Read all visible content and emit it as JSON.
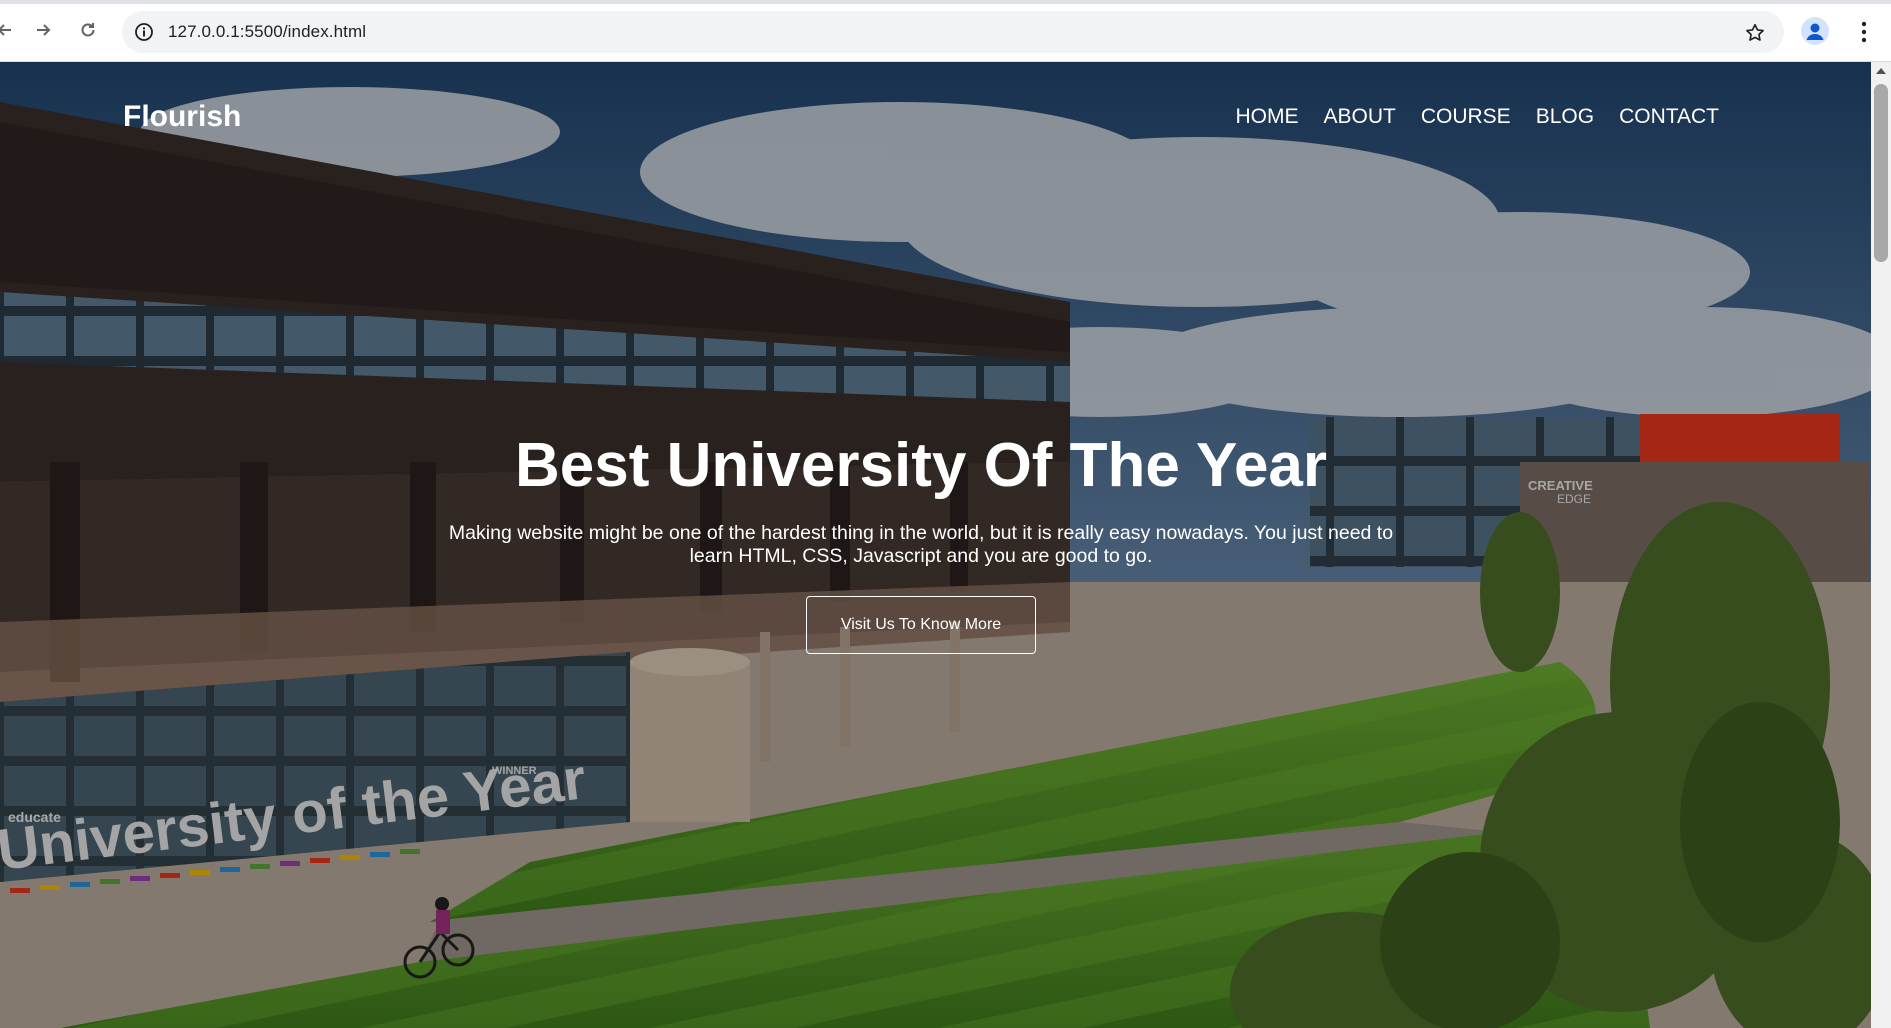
{
  "browser": {
    "url": "127.0.0.1:5500/index.html",
    "icons": [
      "back-icon",
      "forward-icon",
      "reload-icon",
      "info-icon",
      "star-icon",
      "profile-icon",
      "menu-kebab-icon"
    ]
  },
  "site": {
    "logo": "Flourish",
    "nav": [
      "HOME",
      "ABOUT",
      "COURSE",
      "BLOG",
      "CONTACT"
    ]
  },
  "hero": {
    "title": "Best University Of The Year",
    "text": "Making website might be one of the hardest thing in the world, but it is really easy nowadays. You just need to learn HTML, CSS, Javascript and you are good to go.",
    "button": "Visit Us To Know More"
  },
  "photo": {
    "building_sign_line1": "CREATIVE",
    "building_sign_line2": "EDGE",
    "banner_small": "WINNER",
    "banner_brand": "educate",
    "banner_text": "University of the Year"
  },
  "colors": {
    "accent_red": "#e3371e",
    "grass": "#5a9a2a",
    "sky": "#2e557f"
  }
}
